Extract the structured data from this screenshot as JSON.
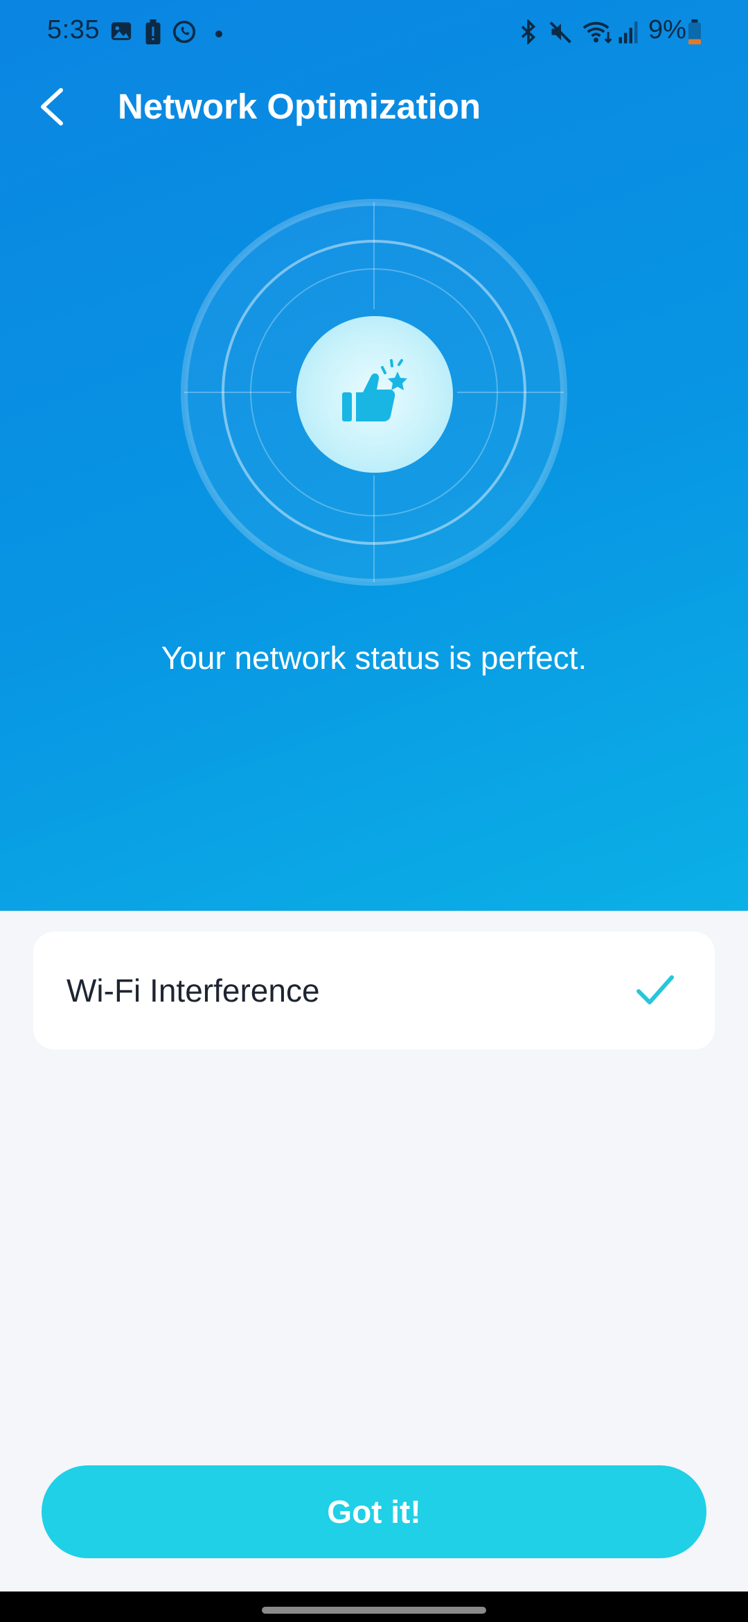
{
  "status_bar": {
    "time": "5:35",
    "battery": "9%",
    "left_icons": [
      "gallery-icon",
      "battery-alert-icon",
      "whatsapp-icon",
      "dot-icon"
    ],
    "right_icons": [
      "bluetooth-icon",
      "mute-icon",
      "wifi-icon",
      "signal-icon",
      "battery-icon"
    ]
  },
  "header": {
    "title": "Network Optimization",
    "back_icon": "chevron-left-icon"
  },
  "status": {
    "message": "Your network status is perfect.",
    "icon": "thumbs-up-icon"
  },
  "checks": [
    {
      "label": "Wi-Fi Interference",
      "state": "passed",
      "icon": "check-icon"
    }
  ],
  "actions": {
    "confirm_label": "Got it!"
  },
  "colors": {
    "hero_start": "#0a85e2",
    "hero_end": "#0bb0e6",
    "accent": "#1fd0e6",
    "check": "#27c6dc"
  }
}
